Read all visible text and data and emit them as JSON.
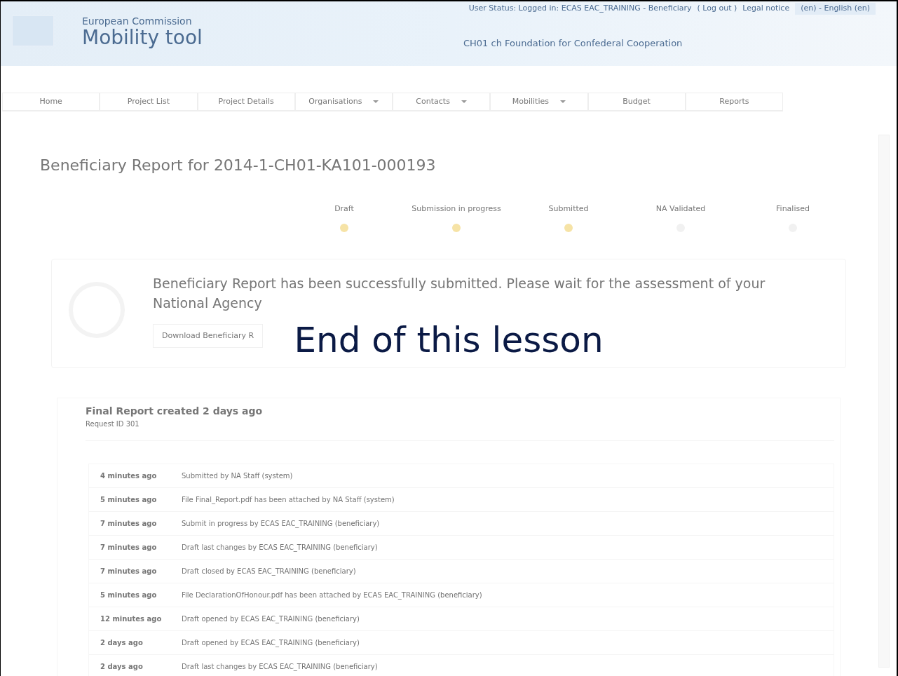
{
  "header": {
    "org": "European Commission",
    "app": "Mobility tool",
    "user_status": "User Status: Logged in: ECAS EAC_TRAINING - Beneficiary",
    "logout": "( Log out )",
    "legal": "Legal notice",
    "language": "(en) - English (en)",
    "organisation": "CH01 ch Foundation for Confederal Cooperation"
  },
  "nav": [
    {
      "label": "Home",
      "dropdown": false
    },
    {
      "label": "Project List",
      "dropdown": false
    },
    {
      "label": "Project Details",
      "dropdown": false
    },
    {
      "label": "Organisations",
      "dropdown": true
    },
    {
      "label": "Contacts",
      "dropdown": true
    },
    {
      "label": "Mobilities",
      "dropdown": true
    },
    {
      "label": "Budget",
      "dropdown": false
    },
    {
      "label": "Reports",
      "dropdown": false
    }
  ],
  "title": "Beneficiary Report for 2014-1-CH01-KA101-000193",
  "steps": [
    {
      "label": "Draft",
      "done": true
    },
    {
      "label": "Submission in progress",
      "done": true
    },
    {
      "label": "Submitted",
      "done": true
    },
    {
      "label": "NA Validated",
      "done": false
    },
    {
      "label": "Finalised",
      "done": false
    }
  ],
  "notice": {
    "message": "Beneficiary Report has been successfully submitted. Please wait for the assessment of your National Agency",
    "button": "Download Beneficiary R"
  },
  "history": {
    "title": "Final Report created 2 days ago",
    "subtitle": "Request ID 301",
    "rows": [
      {
        "time": "4 minutes ago",
        "text": "Submitted by NA Staff",
        "role": "(system)"
      },
      {
        "time": "5 minutes ago",
        "text": "File Final_Report.pdf has been attached by NA Staff",
        "role": "(system)"
      },
      {
        "time": "7 minutes ago",
        "text": "Submit in progress by ECAS EAC_TRAINING",
        "role": "(beneficiary)"
      },
      {
        "time": "7 minutes ago",
        "text": "Draft last changes by ECAS EAC_TRAINING",
        "role": "(beneficiary)"
      },
      {
        "time": "7 minutes ago",
        "text": "Draft closed by ECAS EAC_TRAINING",
        "role": "(beneficiary)"
      },
      {
        "time": "5 minutes ago",
        "text": "File DeclarationOfHonour.pdf has been attached by ECAS EAC_TRAINING",
        "role": "(beneficiary)"
      },
      {
        "time": "12 minutes ago",
        "text": "Draft opened by ECAS EAC_TRAINING",
        "role": "(beneficiary)"
      },
      {
        "time": "2 days ago",
        "text": "Draft opened by ECAS EAC_TRAINING",
        "role": "(beneficiary)"
      },
      {
        "time": "2 days ago",
        "text": "Draft last changes by ECAS EAC_TRAINING",
        "role": "(beneficiary)"
      }
    ]
  },
  "overlay": "End of this lesson"
}
